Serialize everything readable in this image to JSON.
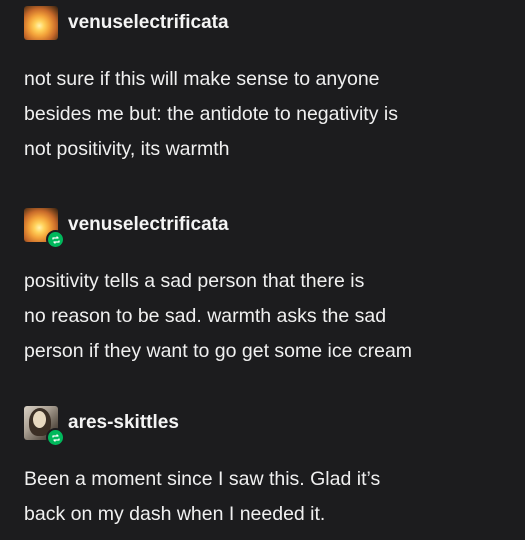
{
  "posts": [
    {
      "username": "venuselectrificata",
      "avatar": "sunset-avatar",
      "reblogged": false,
      "lines": [
        "not sure if this will make sense to anyone",
        "besides me but: the antidote to negativity is",
        "not positivity, its warmth"
      ]
    },
    {
      "username": "venuselectrificata",
      "avatar": "sunset-avatar",
      "reblogged": true,
      "lines": [
        "positivity tells a sad person that there is",
        "no reason to be sad. warmth asks the sad",
        "person if they want to go get some ice cream"
      ]
    },
    {
      "username": "ares-skittles",
      "avatar": "portrait-avatar",
      "reblogged": true,
      "lines": [
        "Been a moment since I saw this. Glad it’s",
        "back on my dash when I needed it."
      ]
    }
  ],
  "colors": {
    "background": "#1c1c1e",
    "text": "#f0f0f0",
    "reblog_badge": "#00b85c"
  }
}
